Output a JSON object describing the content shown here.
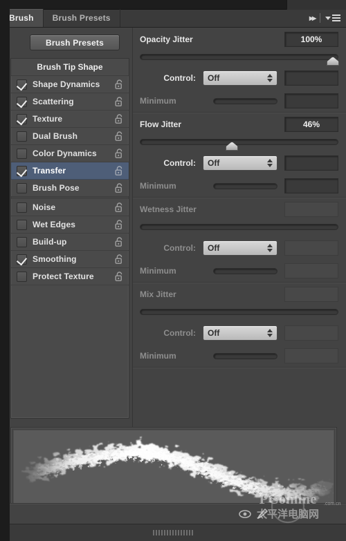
{
  "window": {
    "title": "Brush",
    "tabs": [
      {
        "label": "Brush",
        "active": true
      },
      {
        "label": "Brush Presets",
        "active": false
      }
    ],
    "collapse_icon": "double-chevron-right-icon",
    "menu_icon": "panel-menu-icon"
  },
  "colors": {
    "panel_bg": "#434343",
    "list_bg": "#4a4a4a",
    "selection": "#4e5e78",
    "text": "#e2e2e2",
    "text_dim": "#8e8e8e",
    "track": "#3a3a3a",
    "knob": "#d8d8d8"
  },
  "left": {
    "presets_button": "Brush Presets",
    "list_header": "Brush Tip Shape",
    "items": [
      {
        "label": "Shape Dynamics",
        "checked": true,
        "selected": false,
        "locked": false,
        "group_start": false
      },
      {
        "label": "Scattering",
        "checked": true,
        "selected": false,
        "locked": false,
        "group_start": false
      },
      {
        "label": "Texture",
        "checked": true,
        "selected": false,
        "locked": false,
        "group_start": false
      },
      {
        "label": "Dual Brush",
        "checked": false,
        "selected": false,
        "locked": false,
        "group_start": false
      },
      {
        "label": "Color Dynamics",
        "checked": false,
        "selected": false,
        "locked": false,
        "group_start": false
      },
      {
        "label": "Transfer",
        "checked": true,
        "selected": true,
        "locked": false,
        "group_start": false
      },
      {
        "label": "Brush Pose",
        "checked": false,
        "selected": false,
        "locked": false,
        "group_start": false
      },
      {
        "label": "Noise",
        "checked": false,
        "selected": false,
        "locked": false,
        "group_start": true
      },
      {
        "label": "Wet Edges",
        "checked": false,
        "selected": false,
        "locked": false,
        "group_start": false
      },
      {
        "label": "Build-up",
        "checked": false,
        "selected": false,
        "locked": false,
        "group_start": false
      },
      {
        "label": "Smoothing",
        "checked": true,
        "selected": false,
        "locked": false,
        "group_start": false
      },
      {
        "label": "Protect Texture",
        "checked": false,
        "selected": false,
        "locked": false,
        "group_start": false
      }
    ],
    "lock_icon": "unlocked-padlock-icon"
  },
  "sections": [
    {
      "id": "opacity-jitter",
      "title": "Opacity Jitter",
      "value": "100%",
      "slider_percent": 100,
      "control_label": "Control:",
      "control_value": "Off",
      "control_value_box": "",
      "minimum_label": "Minimum",
      "minimum_value": "",
      "disabled": false
    },
    {
      "id": "flow-jitter",
      "title": "Flow Jitter",
      "value": "46%",
      "slider_percent": 46,
      "control_label": "Control:",
      "control_value": "Off",
      "control_value_box": "",
      "minimum_label": "Minimum",
      "minimum_value": "",
      "disabled": false
    },
    {
      "id": "wetness-jitter",
      "title": "Wetness Jitter",
      "value": "",
      "slider_percent": -1,
      "control_label": "Control:",
      "control_value": "Off",
      "control_value_box": "",
      "minimum_label": "Minimum",
      "minimum_value": "",
      "disabled": true
    },
    {
      "id": "mix-jitter",
      "title": "Mix Jitter",
      "value": "",
      "slider_percent": -1,
      "control_label": "Control:",
      "control_value": "Off",
      "control_value_box": "",
      "minimum_label": "Minimum",
      "minimum_value": "",
      "disabled": true
    }
  ],
  "preview": {
    "name": "brush-stroke-preview",
    "description": "Rough scattered charcoal brush stroke sweeping left to right"
  },
  "footer": {
    "toggle_icon": "brush-preview-toggle-icon",
    "new_brush_icon": "new-brush-icon",
    "watermark": "PConline.com.cn"
  },
  "bottom": {
    "resize_grip": "resize-grip"
  }
}
